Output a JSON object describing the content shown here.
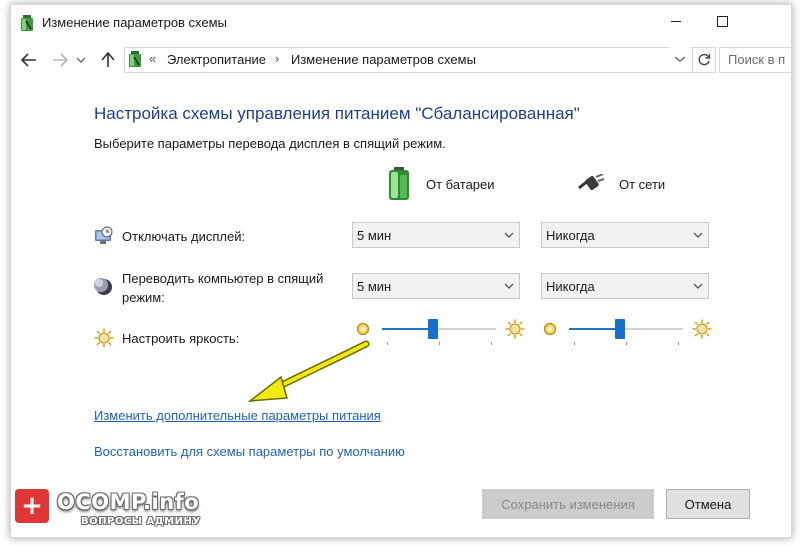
{
  "window": {
    "title": "Изменение параметров схемы"
  },
  "address_bar": {
    "breadcrumbs": [
      "Электропитание",
      "Изменение параметров схемы"
    ],
    "separator_prefix": "«",
    "separator": "›",
    "search_placeholder": "Поиск в п"
  },
  "main": {
    "heading": "Настройка схемы управления питанием \"Сбалансированная\"",
    "subtext": "Выберите параметры перевода дисплея в спящий режим.",
    "columns": {
      "battery": "От батареи",
      "plugged": "От сети"
    },
    "rows": {
      "display_off": {
        "label": "Отключать дисплей:",
        "battery_value": "5 мин",
        "plugged_value": "Никогда"
      },
      "sleep": {
        "label_line1": "Переводить компьютер в спящий",
        "label_line2": "режим:",
        "battery_value": "5 мин",
        "plugged_value": "Никогда"
      },
      "brightness": {
        "label": "Настроить яркость:",
        "battery_level_percent": 45,
        "plugged_level_percent": 45
      }
    },
    "links": {
      "advanced": "Изменить дополнительные параметры питания",
      "restore": "Восстановить для схемы параметры по умолчанию"
    }
  },
  "footer": {
    "save_label": "Сохранить изменения",
    "cancel_label": "Отмена"
  },
  "watermark": {
    "title": "OCOMP.info",
    "subtitle": "ВОПРОСЫ АДМИНУ"
  },
  "colors": {
    "heading": "#1e3f8c",
    "link": "#1e62b8",
    "slider_thumb": "#1a6ed0",
    "annotation_arrow": "#f2ea0e",
    "watermark_red": "#e03636"
  },
  "icons": {
    "title": "power-options-icon",
    "back": "arrow-left-icon",
    "forward": "arrow-right-icon",
    "up": "arrow-up-icon",
    "refresh": "refresh-icon",
    "battery": "battery-icon",
    "plug": "power-plug-icon",
    "display": "monitor-clock-icon",
    "sleep": "moon-icon",
    "brightness": "sun-icon"
  }
}
